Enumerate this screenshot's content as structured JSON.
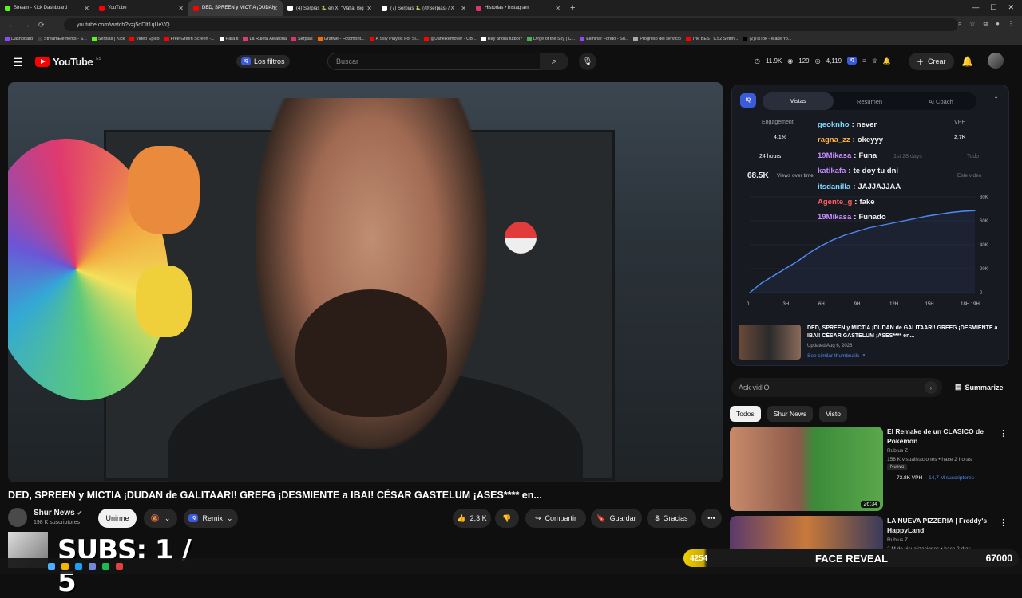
{
  "browser": {
    "tabs": [
      {
        "label": "Stream - Kick Dashboard",
        "color": "#53fc18",
        "active": false
      },
      {
        "label": "YouTube",
        "color": "#ff0000",
        "active": false
      },
      {
        "label": "DED, SPREEN y MICTIA ¡DUDAN",
        "color": "#ff0000",
        "active": true
      },
      {
        "label": "(4) Serpias 🐍 en X: \"Mafia, Big",
        "color": "#ffffff",
        "active": false
      },
      {
        "label": "(7) Serpias 🐍 (@Serpias) / X",
        "color": "#ffffff",
        "active": false
      },
      {
        "label": "Historias • Instagram",
        "color": "#e1306c",
        "active": false
      }
    ],
    "url": "youtube.com/watch?v=j5dDlt1qUeVQ",
    "bookmarks": [
      "Dashboard",
      "StreamElements - S...",
      "Serpias | Kick",
      "Video Epico",
      "Free Green Screen -...",
      "Para ti",
      "La Ruleta Aleatoria",
      "Serpias",
      "GrafMe - Fotomont...",
      "A Silly Playlist For Si...",
      "@JaneRemover - OB...",
      "Hay ahora fútbol?",
      "Dirge of the Sky | C...",
      "Eliminar Fondo - Su...",
      "Progreso del servicio",
      "The BEST CS2 Settin...",
      "(2)TikTok - Make Yo..."
    ]
  },
  "header": {
    "logo_text": "YouTube",
    "logo_region": "ES",
    "filters_label": "Los filtros",
    "search_placeholder": "Buscar",
    "stats": [
      "11.9K",
      "129",
      "4,119"
    ],
    "create_label": "Crear"
  },
  "video": {
    "title": "DED, SPREEN y MICTIA ¡DUDAN de GALITAARI! GREFG ¡DESMIENTE a IBAI! CÉSAR GASTELUM ¡ASES**** en...",
    "channel": "Shur News",
    "subscribers": "198 K suscriptores",
    "join_label": "Unirme",
    "remix_label": "Remix",
    "likes": "2,3 K",
    "share_label": "Compartir",
    "save_label": "Guardar",
    "thanks_label": "Gracias"
  },
  "overlay": {
    "subs_text": "SUBS: 1 / 5",
    "face_reveal_left": "4254",
    "face_reveal_label": "FACE REVEAL",
    "face_reveal_right": "67000"
  },
  "vidiq": {
    "tabs": [
      "Vistas",
      "Resumen",
      "AI Coach"
    ],
    "metrics": [
      {
        "label": "Engagement",
        "value": "4.1%"
      },
      {
        "label": "VPH",
        "value": "2.7K"
      }
    ],
    "ranges": [
      "24 hours",
      "1st 28 days",
      "Todo"
    ],
    "views": "68.5K",
    "views_label": "Views over time",
    "this_video": "Este video",
    "y_ticks": [
      "80K",
      "60K",
      "40K",
      "20K",
      "0"
    ],
    "x_ticks": [
      "0",
      "3H",
      "6H",
      "9H",
      "12H",
      "15H",
      "18H 19H"
    ],
    "similar": {
      "title": "DED, SPREEN y MICTIA ¡DUDAN de GALITAARI! GREFG ¡DESMIENTE a IBAI! CÉSAR GASTELUM ¡ASES**** en...",
      "date": "Updated Aug 6, 2026",
      "link": "See similar thumbnails ↗"
    }
  },
  "chart_data": {
    "type": "line",
    "x": [
      0,
      1,
      2,
      3,
      4,
      5,
      6,
      7,
      8,
      9,
      10,
      11,
      12,
      13,
      14,
      15,
      16,
      17,
      18,
      19
    ],
    "series": [
      {
        "values": [
          0,
          8000,
          14000,
          20000,
          26000,
          33000,
          39000,
          44000,
          48000,
          51000,
          54000,
          56000,
          58000,
          60000,
          62000,
          64000,
          65500,
          67000,
          68000,
          68500
        ]
      }
    ],
    "ylim": [
      0,
      80000
    ],
    "ytick_labels": [
      "0",
      "20K",
      "40K",
      "60K",
      "80K"
    ],
    "xtick_labels": [
      "0",
      "3H",
      "6H",
      "9H",
      "12H",
      "15H",
      "18H 19H"
    ]
  },
  "chat": [
    {
      "user": "geoknho",
      "color": "#7cd8ff",
      "msg": "never"
    },
    {
      "user": "ragna_zz",
      "color": "#ffb347",
      "msg": "okeyyy"
    },
    {
      "user": "19Mikasa",
      "color": "#c58bff",
      "msg": "Funa"
    },
    {
      "user": "katikafa",
      "color": "#c58bff",
      "msg": "te doy tu dni"
    },
    {
      "user": "itsdanilla",
      "color": "#7cd8ff",
      "msg": "JAJJAJJAA"
    },
    {
      "user": "Agente_g",
      "color": "#ff5c5c",
      "msg": "fake"
    },
    {
      "user": "19Mikasa",
      "color": "#c58bff",
      "msg": "Funado"
    }
  ],
  "sidebar": {
    "ask_placeholder": "Ask vidIQ",
    "summarize_label": "Summarize",
    "chips": [
      "Todos",
      "Shur News",
      "Visto"
    ],
    "recs": [
      {
        "title": "El Remake de un CLASICO de Pokémon",
        "channel": "Rubius Z",
        "meta": "158 K visualizaciones • hace 2 horas",
        "badge": "Nuevo",
        "vph": "73.8K VPH",
        "subs": "14,7 M suscriptores",
        "duration": "26:34"
      },
      {
        "title": "LA NUEVA PIZZERIA | Freddy's HappyLand",
        "channel": "Rubius Z",
        "meta": "2 M de visualizaciones • hace 2 días",
        "badge": "",
        "vph": "",
        "subs": "",
        "duration": ""
      }
    ]
  }
}
